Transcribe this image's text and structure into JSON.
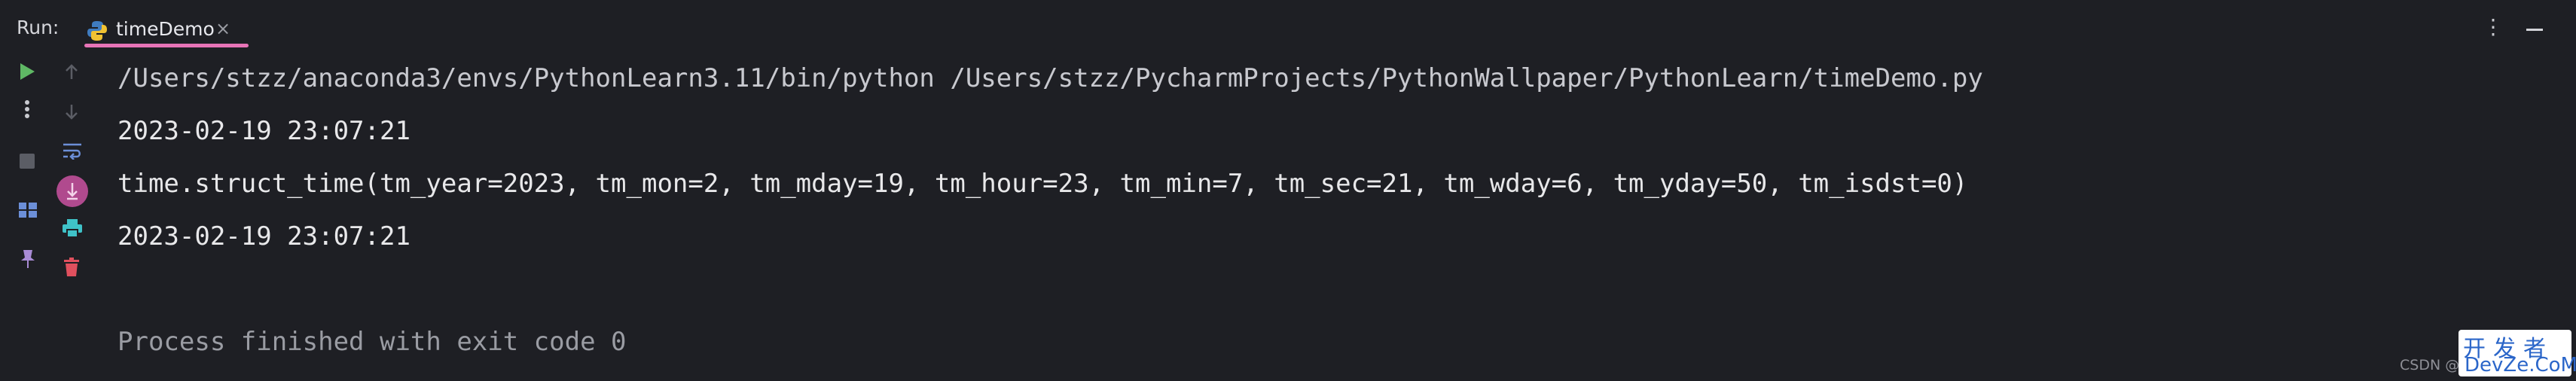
{
  "header": {
    "run_label": "Run:",
    "tab_title": "timeDemo",
    "tab_close": "×",
    "more_glyph": "⋮"
  },
  "gutter": {
    "icons": [
      "run-icon",
      "more-vertical-icon",
      "stop-icon",
      "layout-icon",
      "pin-icon",
      "arrow-up-icon",
      "arrow-down-icon",
      "soft-wrap-icon",
      "scroll-to-end-icon",
      "print-icon",
      "trash-icon"
    ]
  },
  "console": {
    "lines": [
      "/Users/stzz/anaconda3/envs/PythonLearn3.11/bin/python /Users/stzz/PycharmProjects/PythonWallpaper/PythonLearn/timeDemo.py",
      "2023-02-19 23:07:21",
      "time.struct_time(tm_year=2023, tm_mon=2, tm_mday=19, tm_hour=23, tm_min=7, tm_sec=21, tm_wday=6, tm_yday=50, tm_isdst=0)",
      "2023-02-19 23:07:21",
      "Process finished with exit code 0"
    ]
  },
  "watermark": {
    "csdn": "CSDN @",
    "cn": "开发者",
    "en": "DevZe.CoM"
  },
  "colors": {
    "background": "#1e1f24",
    "accent_pink": "#e774b7",
    "run_green": "#5fb865",
    "print_cyan": "#3fc2c8",
    "trash_red": "#e0505e"
  }
}
